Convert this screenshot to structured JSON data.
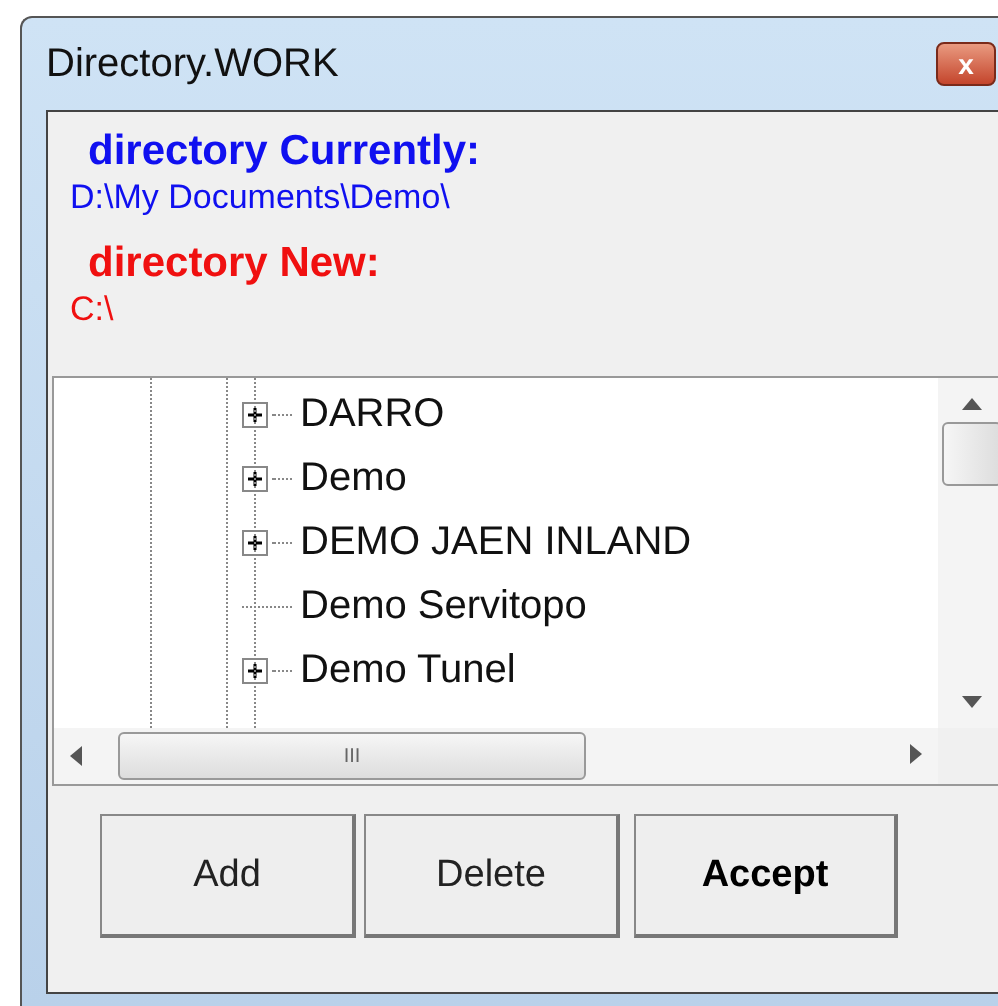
{
  "window": {
    "title": "Directory.WORK",
    "close_symbol": "x"
  },
  "current": {
    "label": "directory Currently:",
    "path": "D:\\My Documents\\Demo\\"
  },
  "new": {
    "label": "directory New:",
    "path": "C:\\"
  },
  "tree": {
    "items": [
      {
        "label": "DARRO",
        "kind": "collapsed"
      },
      {
        "label": "Demo",
        "kind": "collapsed"
      },
      {
        "label": "DEMO JAEN INLAND",
        "kind": "collapsed"
      },
      {
        "label": "Demo Servitopo",
        "kind": "leaf"
      },
      {
        "label": "Demo Tunel",
        "kind": "collapsed"
      }
    ],
    "hscroll_grip": "III"
  },
  "buttons": [
    {
      "label": "Add",
      "default": false
    },
    {
      "label": "Delete",
      "default": false
    },
    {
      "label": "Accept",
      "default": true
    }
  ]
}
